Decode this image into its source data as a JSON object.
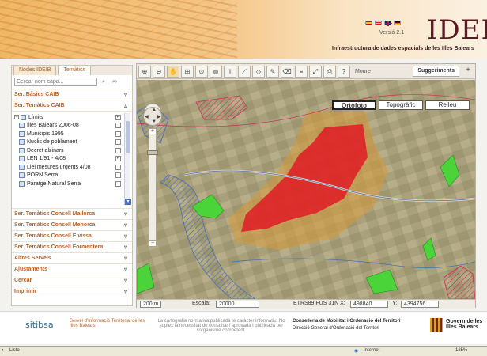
{
  "banner": {
    "version": "Versió 2.1",
    "logo": "IDEIB",
    "subtitle": "Infraestructura de dades espacials de les Illes Balears"
  },
  "colors": {
    "accent": "#b8632d",
    "banner": "#f0b765",
    "urban": "#e01b24",
    "protected": "#c9335a",
    "green": "#4bd43a"
  },
  "left_panel": {
    "tabs": [
      "Nodes IDEIB",
      "Temàtics"
    ],
    "search": {
      "placeholder": "Cercar nom capa..."
    },
    "sections_top": [
      "Ser. Bàsics CAIB",
      "Ser. Temàtics CAIB"
    ],
    "tree": [
      {
        "label": "Límits",
        "checked": true,
        "root": true
      },
      {
        "label": "Illes Balears 2006-08",
        "checked": false
      },
      {
        "label": "Municipis 1995",
        "checked": false
      },
      {
        "label": "Nuclis de poblament",
        "checked": false
      },
      {
        "label": "Decret alzinars",
        "checked": false
      },
      {
        "label": "LEN 1/91 - 4/08",
        "checked": true
      },
      {
        "label": "Llei mesures urgents 4/08",
        "checked": false
      },
      {
        "label": "PORN Serra",
        "checked": false
      },
      {
        "label": "Paratge Natural Serra",
        "checked": false
      }
    ],
    "sections_bottom": [
      "Ser. Temàtics Consell Mallorca",
      "Ser. Temàtics Consell Menorca",
      "Ser. Temàtics Consell Eivissa",
      "Ser. Temàtics Consell Formentera",
      "Altres Serveis",
      "Ajustaments",
      "Cercar",
      "Imprimir"
    ]
  },
  "map": {
    "tool_moure": "Moure",
    "suggeriments": "Suggeriments",
    "layers": [
      "Ortofoto",
      "Topogràfic",
      "Relleu"
    ],
    "active_layer": "Ortofoto",
    "zoom_level": 0.86,
    "status": {
      "scale_bar": "200 m",
      "escala_label": "Escala:",
      "escala_value": "20000",
      "coords_label": "ETRS89 FUS 31N X:",
      "x_value": "498840",
      "y_label": "Y:",
      "y_value": "4394756"
    }
  },
  "footer": {
    "sitibsa": "sitibsa",
    "service": "Servei d'Informació Territorial de les Illes Balears",
    "notice": "La cartografia normativa publicada té caràcter informatiu. No suplex la necessitat de consultar l'aprovada i publicada per l'organisme competent.",
    "conselleria": "Conselleria de Mobilitat i Ordenació del Territori",
    "direccio": "Direcció General d'Ordenació del Territori",
    "govern": "Govern de les Illes Balears"
  },
  "browser": {
    "status": "Listo",
    "zone": "Internet",
    "zoom": "125%"
  }
}
